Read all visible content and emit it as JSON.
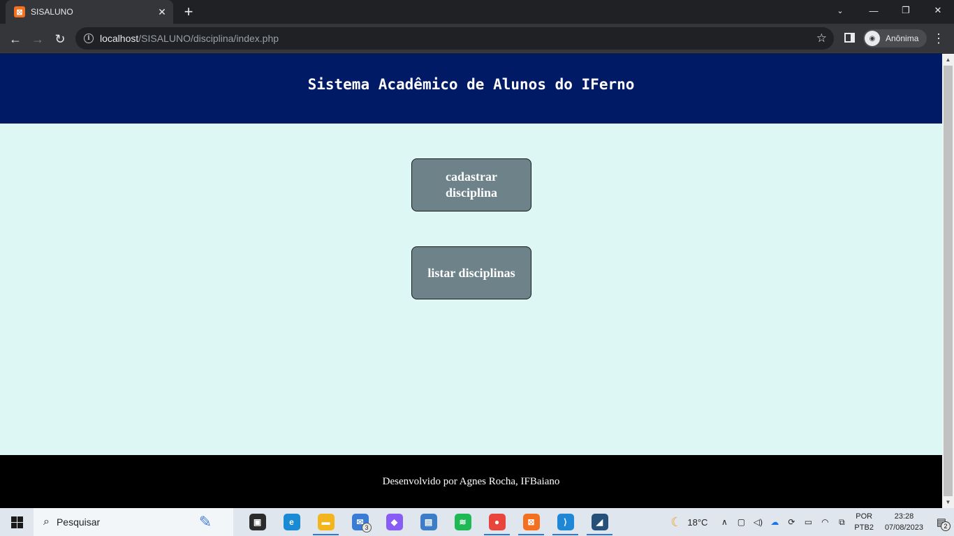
{
  "browser": {
    "tab": {
      "title": "SISALUNO",
      "favicon": "xampp-icon"
    },
    "window_controls": {
      "minimize": "—",
      "restore": "❐",
      "close": "✕",
      "tab_search": "⌄"
    },
    "omnibox": {
      "host": "localhost",
      "path": "/SISALUNO/disciplina/index.php"
    },
    "profile_label": "Anônima"
  },
  "page": {
    "header_title": "Sistema Acadêmico de Alunos do IFerno",
    "buttons": [
      {
        "label": "cadastrar disciplina"
      },
      {
        "label": "listar disciplinas"
      }
    ],
    "footer_text": "Desenvolvido por Agnes Rocha, IFBaiano",
    "colors": {
      "header_bg": "#001a66",
      "main_bg": "#dcf7f4",
      "button_bg": "#6d8289",
      "footer_bg": "#000000"
    }
  },
  "taskbar": {
    "search_placeholder": "Pesquisar",
    "apps": [
      {
        "name": "task-view-icon",
        "glyph": "▣",
        "color": "#2b2b2b"
      },
      {
        "name": "edge-icon",
        "glyph": "e",
        "color": "#1a8ad4"
      },
      {
        "name": "file-explorer-icon",
        "glyph": "▬",
        "color": "#f3b51c"
      },
      {
        "name": "mail-icon",
        "glyph": "✉",
        "color": "#3a7bd5",
        "badge": "3"
      },
      {
        "name": "copilot-icon",
        "glyph": "◆",
        "color": "#8a5cf6"
      },
      {
        "name": "news-icon",
        "glyph": "▤",
        "color": "#3d7dc8"
      },
      {
        "name": "spotify-icon",
        "glyph": "≋",
        "color": "#1db954"
      },
      {
        "name": "chrome-icon",
        "glyph": "●",
        "color": "#e8453c"
      },
      {
        "name": "xampp-icon",
        "glyph": "⊠",
        "color": "#f37021"
      },
      {
        "name": "vscode-icon",
        "glyph": "⟩",
        "color": "#1e88d6"
      },
      {
        "name": "mysql-workbench-icon",
        "glyph": "◢",
        "color": "#24507a"
      }
    ],
    "weather": {
      "temp": "18°C"
    },
    "language": {
      "line1": "POR",
      "line2": "PTB2"
    },
    "clock": {
      "time": "23:28",
      "date": "07/08/2023"
    },
    "notification_count": "2"
  }
}
